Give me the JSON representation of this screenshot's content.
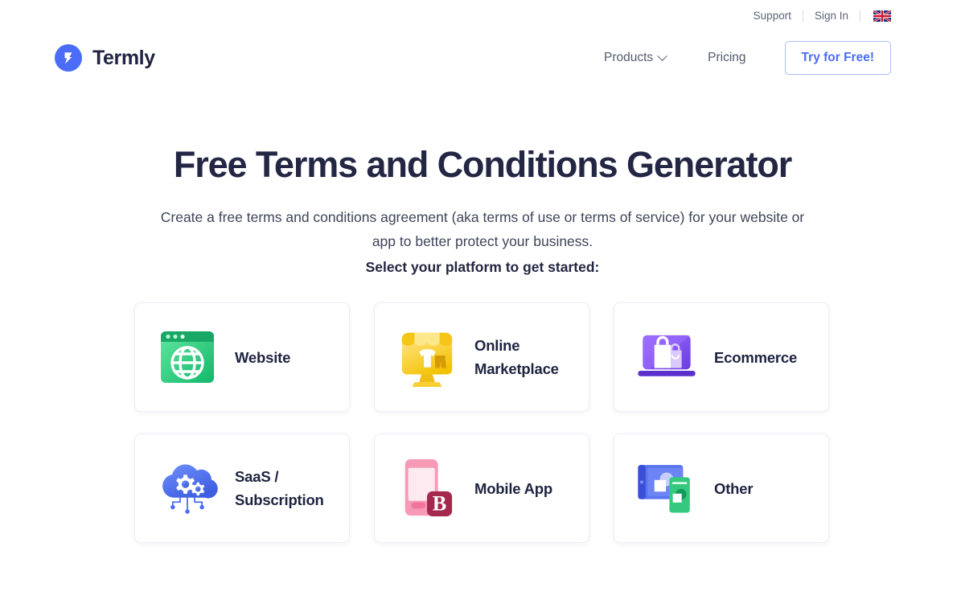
{
  "utility": {
    "support_label": "Support",
    "signin_label": "Sign In",
    "flag_icon": "uk-flag-icon"
  },
  "header": {
    "brand_name": "Termly",
    "brand_icon": "termly-logo-icon",
    "nav": [
      {
        "label": "Products",
        "icon": "chevron-down-icon"
      },
      {
        "label": "Pricing",
        "icon": ""
      }
    ],
    "cta_label": "Try for Free!"
  },
  "hero": {
    "title": "Free Terms and Conditions Generator",
    "subtitle": "Create a free terms and conditions agreement (aka terms of use or terms of service) for your website or app to better protect your business.",
    "prompt": "Select your platform to get started:"
  },
  "platforms": [
    {
      "label": "Website",
      "icon": "website-browser-globe-icon"
    },
    {
      "label": "Online Marketplace",
      "icon": "online-marketplace-storefront-icon"
    },
    {
      "label": "Ecommerce",
      "icon": "ecommerce-laptop-shopping-bag-icon"
    },
    {
      "label": "SaaS / Subscription",
      "icon": "saas-cloud-gears-icon"
    },
    {
      "label": "Mobile App",
      "icon": "mobile-app-phone-icon"
    },
    {
      "label": "Other",
      "icon": "other-devices-icon"
    }
  ],
  "colors": {
    "brand_blue": "#4a6cf7",
    "heading_navy": "#232744",
    "website_green": "#2ecc82",
    "marketplace_gold": "#f5c518",
    "ecommerce_purple": "#7a4ff0",
    "saas_blue": "#4a6cf7",
    "mobile_pink": "#f490ad",
    "mobile_badge": "#a5294d",
    "other_blue": "#5a74f0",
    "other_green": "#35c97f"
  }
}
